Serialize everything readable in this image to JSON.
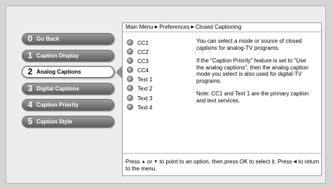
{
  "menu": {
    "items": [
      {
        "num": "0",
        "label": "Go Back",
        "selected": false
      },
      {
        "num": "1",
        "label": "Caption Display",
        "selected": false
      },
      {
        "num": "2",
        "label": "Analog Captions",
        "selected": true
      },
      {
        "num": "3",
        "label": "Digital Captions",
        "selected": false
      },
      {
        "num": "4",
        "label": "Caption Priority",
        "selected": false
      },
      {
        "num": "5",
        "label": "Caption Style",
        "selected": false
      }
    ]
  },
  "breadcrumb": [
    "Main Menu",
    "Preferences",
    "Closed Captioning"
  ],
  "options": [
    "CC1",
    "CC2",
    "CC3",
    "CC4",
    "Text 1",
    "Text 2",
    "Text 3",
    "Text 4"
  ],
  "description": [
    "You can select a mode or source of closed captions for analog-TV programs.",
    "If the \"Caption Priority\" feature is set to \"Use the analog captions\", then the analog caption mode you select is also used for digital-TV programs.",
    "Note: CC1 and Text 1 are the primary caption and text services."
  ],
  "footer": {
    "part1": "Press",
    "part2": "or",
    "part3": "to point to an option, then press OK to select it. Press",
    "part4": "to return to the menu."
  }
}
